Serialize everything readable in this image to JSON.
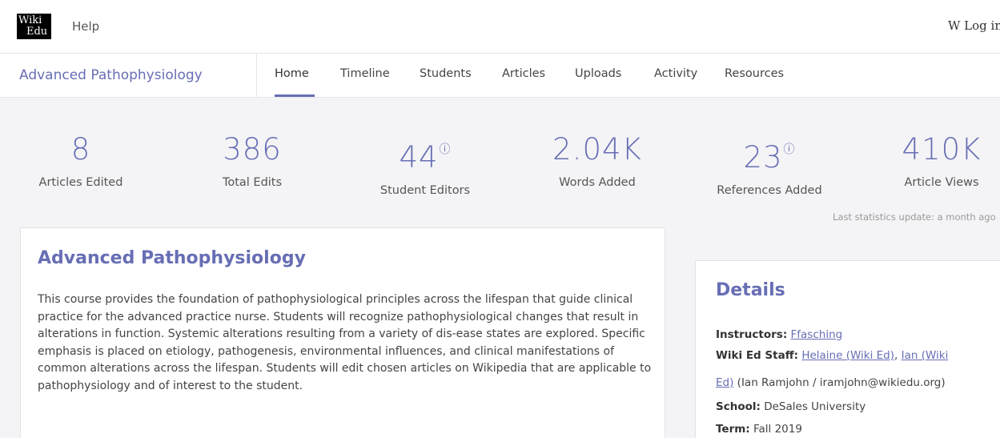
{
  "header": {
    "logo_line1": "Wiki",
    "logo_line2": "Edu",
    "help": "Help",
    "login": "W Log in"
  },
  "course_nav": {
    "title": "Advanced Pathophysiology",
    "tabs": [
      "Home",
      "Timeline",
      "Students",
      "Articles",
      "Uploads",
      "Activity",
      "Resources"
    ],
    "active_tab": "Home"
  },
  "stats": [
    {
      "value": "8",
      "label": "Articles Edited",
      "info": false
    },
    {
      "value": "386",
      "label": "Total Edits",
      "info": false
    },
    {
      "value": "44",
      "label": "Student Editors",
      "info": true
    },
    {
      "value": "2.04K",
      "label": "Words Added",
      "info": false
    },
    {
      "value": "23",
      "label": "References Added",
      "info": true
    },
    {
      "value": "410K",
      "label": "Article Views",
      "info": false
    }
  ],
  "info_glyph": "ⓘ",
  "last_update": "Last statistics update: a month ago",
  "description": {
    "title": "Advanced Pathophysiology",
    "text": "This course provides the foundation of pathophysiological principles across the lifespan that guide clinical practice for the advanced practice nurse. Students will recognize pathophysiological changes that result in alterations in function. Systemic alterations resulting from a variety of dis-ease states are explored. Specific emphasis is placed on etiology, pathogenesis, environmental influences, and clinical manifestations of common alterations across the lifespan. Students will edit chosen articles on Wikipedia that are applicable to pathophysiology and of interest to the student."
  },
  "details": {
    "title": "Details",
    "instructors_label": "Instructors:",
    "instructor": "Ffasching",
    "staff_label": "Wiki Ed Staff:",
    "staff1": "Helaine (Wiki Ed)",
    "staff_sep": ",",
    "staff2_part1": "Ian (Wiki",
    "staff2_part2": "Ed)",
    "staff_contact": "(Ian Ramjohn / iramjohn@wikiedu.org)",
    "school_label": "School:",
    "school": "DeSales University",
    "term_label": "Term:",
    "term": "Fall 2019"
  },
  "colors": {
    "accent": "#676eb4",
    "background": "#f4f4f6"
  }
}
